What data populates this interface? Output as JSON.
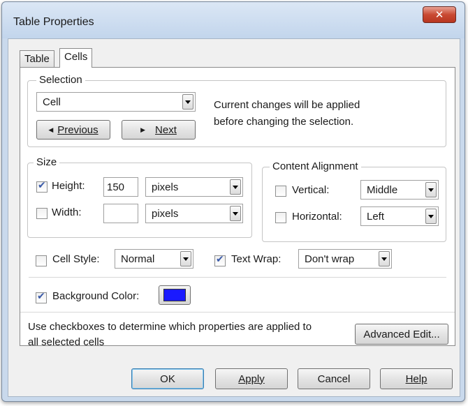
{
  "window": {
    "title": "Table Properties",
    "close_glyph": "✕"
  },
  "tabs": [
    {
      "label": "Table"
    },
    {
      "label": "Cells"
    }
  ],
  "selection": {
    "legend": "Selection",
    "combo_value": "Cell",
    "prev_label": "Previous",
    "next_label": "Next",
    "note_line1": "Current changes will be applied",
    "note_line2": "before changing the selection."
  },
  "size": {
    "legend": "Size",
    "height_label": "Height:",
    "height_checked": true,
    "height_value": "150",
    "height_unit": "pixels",
    "width_label": "Width:",
    "width_checked": false,
    "width_value": "",
    "width_unit": "pixels"
  },
  "alignment": {
    "legend": "Content Alignment",
    "vertical_label": "Vertical:",
    "vertical_checked": false,
    "vertical_value": "Middle",
    "horizontal_label": "Horizontal:",
    "horizontal_checked": false,
    "horizontal_value": "Left"
  },
  "cell_style": {
    "label": "Cell Style:",
    "checked": false,
    "value": "Normal"
  },
  "text_wrap": {
    "label": "Text Wrap:",
    "checked": true,
    "value": "Don't wrap"
  },
  "background": {
    "label": "Background Color:",
    "checked": true,
    "color": "#1a1aff"
  },
  "footer_note": {
    "line1": "Use checkboxes to determine which properties are applied to",
    "line2": "all selected cells"
  },
  "advanced_label": "Advanced Edit...",
  "buttons": {
    "ok": "OK",
    "apply": "Apply",
    "cancel": "Cancel",
    "help": "Help"
  }
}
